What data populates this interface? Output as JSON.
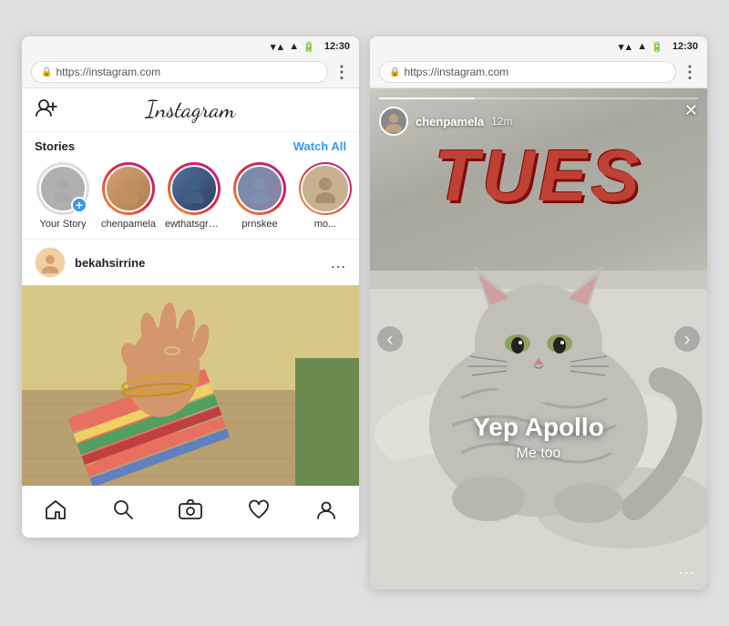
{
  "phone_left": {
    "status_bar": {
      "time": "12:30"
    },
    "url_bar": {
      "url": "https://instagram.com",
      "dots_label": "⋮"
    },
    "header": {
      "add_person_icon": "👤+",
      "logo": "Instagram"
    },
    "stories_section": {
      "title": "Stories",
      "watch_all": "Watch All",
      "items": [
        {
          "username": "Your Story",
          "avatar_color": "#ddd",
          "has_gradient": false,
          "is_your_story": true
        },
        {
          "username": "chenpamela",
          "avatar_color": "#c0a080",
          "has_gradient": true
        },
        {
          "username": "ewthatsgross",
          "avatar_color": "#7090c0",
          "has_gradient": true
        },
        {
          "username": "prnskee",
          "avatar_color": "#90b0d0",
          "has_gradient": true
        },
        {
          "username": "mo...",
          "avatar_color": "#b0b0b0",
          "has_gradient": true
        }
      ]
    },
    "post": {
      "username": "bekahsirrine",
      "dots": "…"
    },
    "bottom_nav": {
      "icons": [
        "🏠",
        "🔍",
        "📷",
        "🤍",
        "👤"
      ]
    }
  },
  "phone_right": {
    "status_bar": {
      "time": "12:30"
    },
    "url_bar": {
      "url": "https://instagram.com",
      "dots_label": "⋮"
    },
    "story": {
      "username": "chenpamela",
      "time_ago": "12m",
      "close": "✕",
      "tues_text": "TUES",
      "caption_main": "Yep Apollo",
      "caption_sub": "Me too",
      "nav_left": "‹",
      "nav_right": "›",
      "bottom_dots": "…"
    }
  }
}
